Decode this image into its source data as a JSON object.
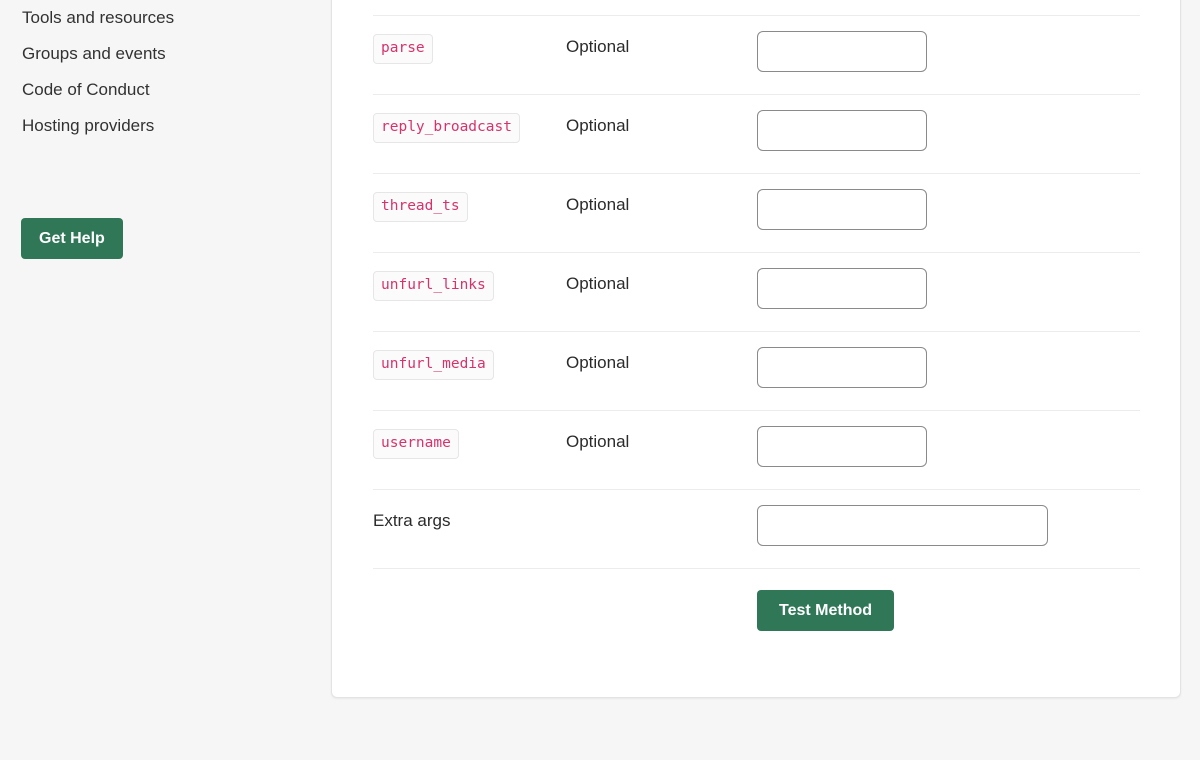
{
  "sidebar": {
    "nav_items": [
      {
        "label": "Tools and resources"
      },
      {
        "label": "Groups and events"
      },
      {
        "label": "Code of Conduct"
      },
      {
        "label": "Hosting providers"
      }
    ],
    "get_help_label": "Get Help"
  },
  "method_tester": {
    "columns": {
      "name": "",
      "requirement": "",
      "value": ""
    },
    "rows": [
      {
        "name": "parse",
        "name_is_code": true,
        "requirement": "Optional",
        "value": "",
        "placeholder": "",
        "wide": false
      },
      {
        "name": "reply_broadcast",
        "name_is_code": true,
        "requirement": "Optional",
        "value": "",
        "placeholder": "",
        "wide": false
      },
      {
        "name": "thread_ts",
        "name_is_code": true,
        "requirement": "Optional",
        "value": "",
        "placeholder": "",
        "wide": false
      },
      {
        "name": "unfurl_links",
        "name_is_code": true,
        "requirement": "Optional",
        "value": "",
        "placeholder": "",
        "wide": false
      },
      {
        "name": "unfurl_media",
        "name_is_code": true,
        "requirement": "Optional",
        "value": "",
        "placeholder": "",
        "wide": false
      },
      {
        "name": "username",
        "name_is_code": true,
        "requirement": "Optional",
        "value": "",
        "placeholder": "",
        "wide": false
      },
      {
        "name": "Extra args",
        "name_is_code": false,
        "requirement": "",
        "value": "",
        "placeholder": "",
        "wide": true
      }
    ],
    "submit_label": "Test Method"
  },
  "colors": {
    "brand_green": "#2f7757",
    "code_text": "#d6336c",
    "page_background": "#f6f6f6",
    "card_background": "#ffffff",
    "divider": "#ececec",
    "input_border": "#8a8a8a",
    "text": "#2b2b2b"
  }
}
